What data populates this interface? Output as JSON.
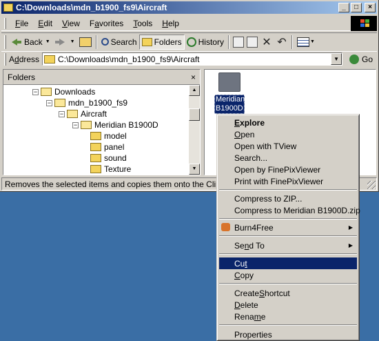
{
  "window": {
    "title": "C:\\Downloads\\mdn_b1900_fs9\\Aircraft",
    "controls": [
      "_",
      "□",
      "×"
    ]
  },
  "menubar": {
    "items": [
      {
        "label": "File",
        "hotkey": "F",
        "rest": "ile"
      },
      {
        "label": "Edit",
        "hotkey": "E",
        "rest": "dit"
      },
      {
        "label": "View",
        "hotkey": "V",
        "rest": "iew"
      },
      {
        "label": "Favorites",
        "hotkey": "a",
        "pre": "F",
        "rest": "vorites"
      },
      {
        "label": "Tools",
        "hotkey": "T",
        "rest": "ools"
      },
      {
        "label": "Help",
        "hotkey": "H",
        "rest": "elp"
      }
    ]
  },
  "toolbar": {
    "back_label": "Back",
    "search_label": "Search",
    "folders_label": "Folders",
    "history_label": "History"
  },
  "address": {
    "label_hotkey": "d",
    "label_pre": "A",
    "label_rest": "dress",
    "value": "C:\\Downloads\\mdn_b1900_fs9\\Aircraft",
    "go_label": "Go"
  },
  "folders_pane": {
    "header": "Folders",
    "close": "×",
    "tree": [
      {
        "label": "Downloads",
        "expander": "−",
        "open": true,
        "selected": false
      },
      {
        "label": "mdn_b1900_fs9",
        "expander": "−",
        "open": true,
        "selected": false
      },
      {
        "label": "Aircraft",
        "expander": "−",
        "open": true,
        "selected": false
      },
      {
        "label": "Meridian B1900D",
        "expander": "−",
        "open": true,
        "selected": false
      },
      {
        "label": "model",
        "expander": "",
        "open": false,
        "selected": false
      },
      {
        "label": "panel",
        "expander": "",
        "open": false,
        "selected": false
      },
      {
        "label": "sound",
        "expander": "",
        "open": false,
        "selected": false
      },
      {
        "label": "Texture",
        "expander": "",
        "open": false,
        "selected": false
      }
    ]
  },
  "content": {
    "item_line1": "Meridian",
    "item_line2": "B1900D"
  },
  "statusbar": {
    "text": "Removes the selected items and copies them onto the Clipboard."
  },
  "context_menu": {
    "items": [
      {
        "label": "Explore",
        "type": "item",
        "bold": true
      },
      {
        "label": "Open",
        "type": "item"
      },
      {
        "label": "Open with TView",
        "type": "item"
      },
      {
        "label": "Search...",
        "type": "item"
      },
      {
        "label": "Open by FinePixViewer",
        "type": "item"
      },
      {
        "label": "Print with FinePixViewer",
        "type": "item"
      },
      {
        "type": "separator"
      },
      {
        "label": "Compress to ZIP...",
        "type": "item"
      },
      {
        "label": "Compress to Meridian B1900D.zip",
        "type": "item"
      },
      {
        "type": "separator"
      },
      {
        "label": "Burn4Free",
        "type": "item",
        "submenu": true,
        "icon": "burn4free-icon"
      },
      {
        "type": "separator"
      },
      {
        "label": "Send To",
        "type": "item",
        "submenu": true
      },
      {
        "type": "separator"
      },
      {
        "label": "Cut",
        "type": "item",
        "highlight": true
      },
      {
        "label": "Copy",
        "type": "item"
      },
      {
        "type": "separator"
      },
      {
        "label": "Create Shortcut",
        "type": "item"
      },
      {
        "label": "Delete",
        "type": "item"
      },
      {
        "label": "Rename",
        "type": "item"
      },
      {
        "type": "separator"
      },
      {
        "label": "Properties",
        "type": "item"
      }
    ]
  },
  "colors": {
    "titlebar_start": "#0a246a",
    "titlebar_end": "#a6caf0",
    "desktop": "#3a6ea5",
    "face": "#d4d0c8",
    "highlight": "#0a246a"
  }
}
